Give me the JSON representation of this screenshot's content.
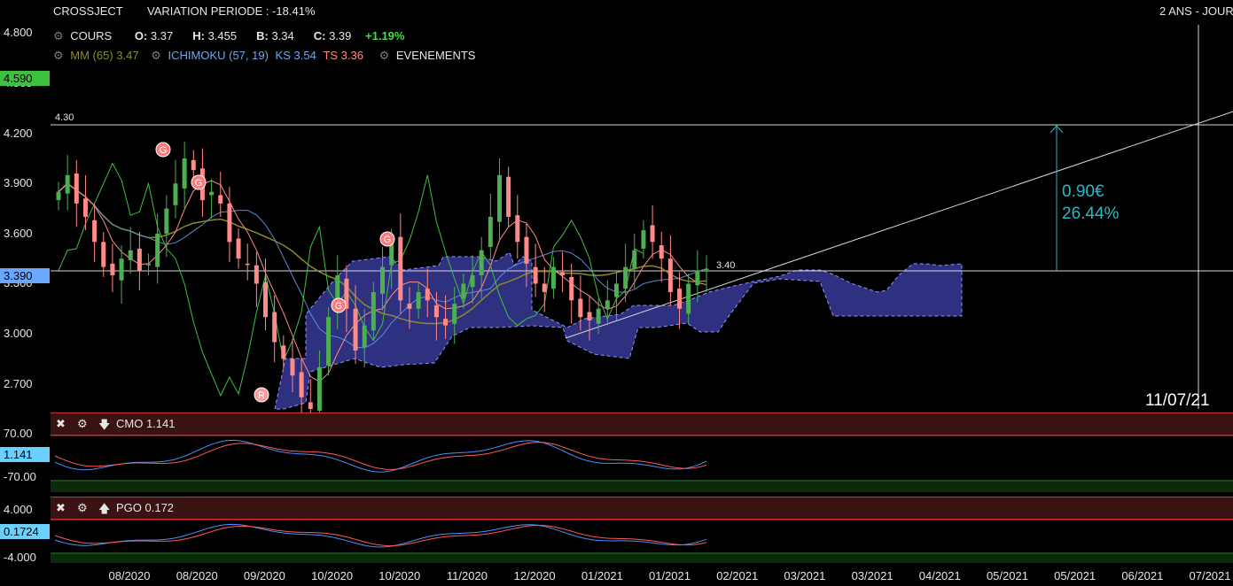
{
  "header": {
    "ticker": "CROSSJECT",
    "variation": "VARIATION PERIODE : -18.41%",
    "period": "2 ANS - JOUR",
    "cours": "COURS",
    "ohlc": [
      {
        "k": "O:",
        "v": "3.37"
      },
      {
        "k": "H:",
        "v": "3.455"
      },
      {
        "k": "B:",
        "v": "3.34"
      },
      {
        "k": "C:",
        "v": "3.39"
      }
    ],
    "change": "+1.19%",
    "mm": "MM (65) 3.47",
    "ichimoku": "ICHIMOKU (57, 19)",
    "ks": "KS 3.54",
    "ts": "TS 3.36",
    "evenements": "EVENEMENTS"
  },
  "badges": {
    "high": "4.590",
    "last": "3.390",
    "cmo": "1.141",
    "pgo": "0.1724"
  },
  "annotations": {
    "level_430": "4.30",
    "level_340": "3.40",
    "gain_eur": "0.90€",
    "gain_pct": "26.44%",
    "cursor_date": "11/07/21",
    "events": [
      "G",
      "G",
      "G",
      "G",
      "R"
    ]
  },
  "panels": {
    "cmo": {
      "label": "CMO 1.141",
      "yticks": [
        "70.00",
        "-70.00"
      ]
    },
    "pgo": {
      "label": "PGO 0.172",
      "yticks": [
        "4.000",
        "-4.000"
      ]
    }
  },
  "colors": {
    "bull": "#4caf50",
    "bear": "#ff8a8a",
    "cloud": "#2f3180",
    "mm": "#8a8a2a",
    "kijun": "#5b8bd6",
    "tenkan": "#ff8a80",
    "chikou": "#3fbf3f",
    "accent": "#2ab7c6"
  },
  "chart_data": {
    "type": "candlestick",
    "yticks": [
      "4.800",
      "4.500",
      "4.200",
      "3.900",
      "3.600",
      "3.300",
      "3.000",
      "2.700"
    ],
    "ylim": [
      2.55,
      4.85
    ],
    "xticks": [
      "08/2020",
      "08/2020",
      "09/2020",
      "10/2020",
      "10/2020",
      "11/2020",
      "12/2020",
      "01/2021",
      "01/2021",
      "02/2021",
      "03/2021",
      "03/2021",
      "04/2021",
      "05/2021",
      "05/2021",
      "06/2021",
      "07/2021"
    ],
    "series": [
      {
        "name": "MM (65)",
        "value": 3.47
      },
      {
        "name": "KS",
        "value": 3.54
      },
      {
        "name": "TS",
        "value": 3.36
      }
    ],
    "close": [
      3.85,
      3.95,
      3.78,
      3.7,
      3.55,
      3.4,
      3.35,
      3.45,
      3.5,
      3.38,
      3.42,
      3.6,
      3.75,
      3.9,
      4.05,
      3.98,
      3.8,
      3.85,
      3.78,
      3.55,
      3.45,
      3.42,
      3.3,
      3.1,
      2.95,
      2.85,
      2.75,
      2.62,
      2.55,
      2.8,
      3.1,
      3.35,
      3.15,
      2.9,
      3.05,
      3.25,
      3.4,
      3.55,
      3.2,
      3.15,
      3.25,
      3.2,
      3.1,
      3.05,
      3.18,
      3.3,
      3.35,
      3.5,
      3.7,
      3.95,
      3.7,
      3.55,
      3.42,
      3.3,
      3.25,
      3.4,
      3.35,
      3.2,
      3.1,
      3.08,
      3.15,
      3.2,
      3.3,
      3.4,
      3.5,
      3.62,
      3.55,
      3.45,
      3.25,
      3.15,
      3.3,
      3.38,
      3.39
    ]
  }
}
